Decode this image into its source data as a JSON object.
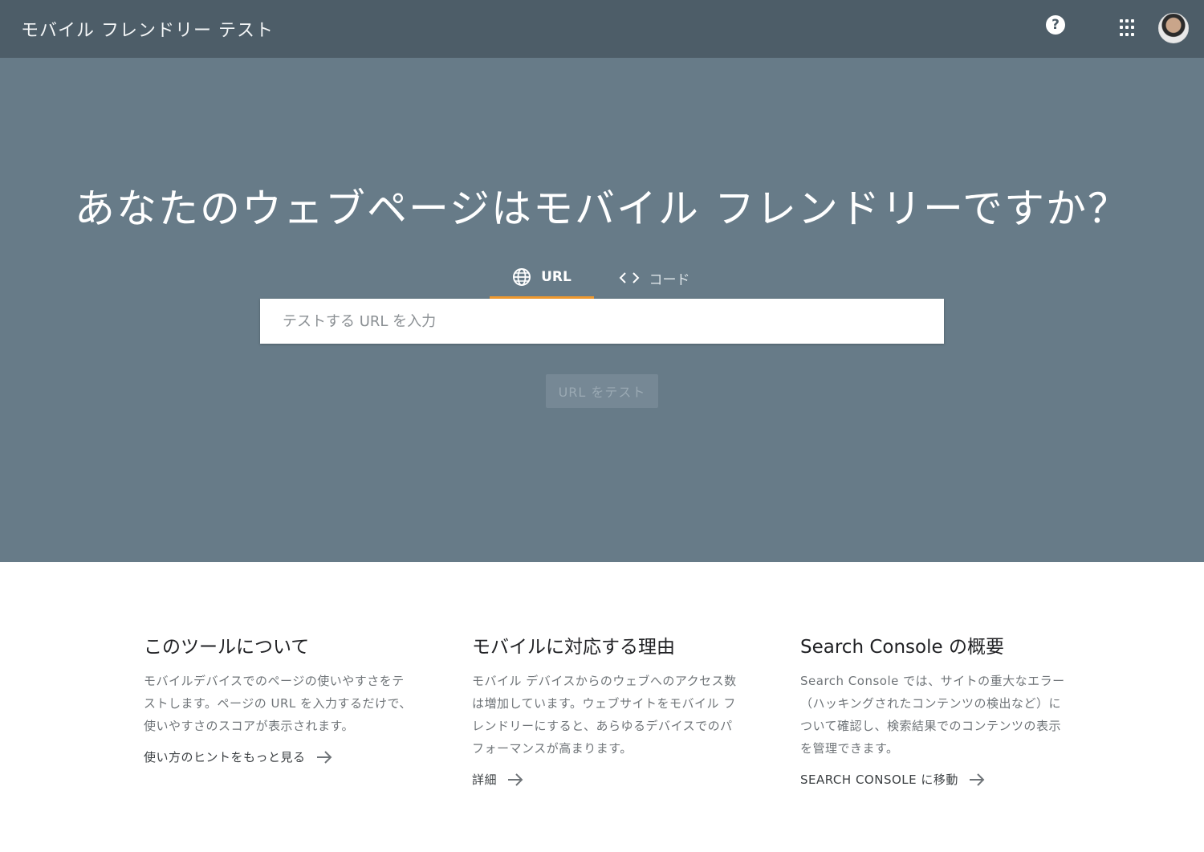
{
  "header": {
    "title": "モバイル フレンドリー テスト",
    "help_icon": "?"
  },
  "hero": {
    "title": "あなたのウェブページはモバイル フレンドリーですか？",
    "tabs": [
      {
        "label": "URL",
        "icon": "globe-icon",
        "active": true
      },
      {
        "label": "コード",
        "icon": "code-icon",
        "active": false
      }
    ],
    "search": {
      "placeholder": "テストする URL を入力",
      "value": ""
    },
    "test_button": "URL をテスト"
  },
  "info": [
    {
      "heading": "このツールについて",
      "text": "モバイルデバイスでのページの使いやすさをテストします。ページの URL を入力するだけで、使いやすさのスコアが表示されます。",
      "link": "使い方のヒントをもっと見る"
    },
    {
      "heading": "モバイルに対応する理由",
      "text": "モバイル デバイスからのウェブへのアクセス数は増加しています。ウェブサイトをモバイル フレンドリーにすると、あらゆるデバイスでのパフォーマンスが高まります。",
      "link": "詳細"
    },
    {
      "heading": "Search Console の概要",
      "text": "Search Console では、サイトの重大なエラー（ハッキングされたコンテンツの検出など）について確認し、検索結果でのコンテンツの表示を管理できます。",
      "link": "SEARCH CONSOLE に移動"
    }
  ],
  "colors": {
    "topbar": "#4d5d68",
    "hero": "#677b88",
    "tab_indicator": "#f29a2e"
  }
}
